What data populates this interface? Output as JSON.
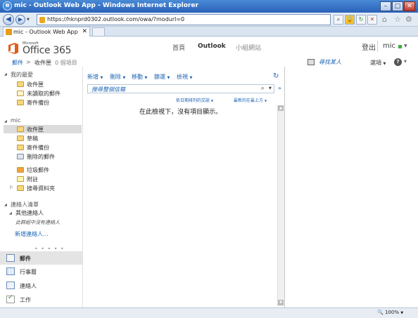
{
  "window": {
    "title": "mic - Outlook Web App - Windows Internet Explorer",
    "url": "https://hknprd0302.outlook.com/owa/?modurl=0",
    "tab_title": "mic - Outlook Web App",
    "controls": {
      "minimize": "–",
      "maximize": "□",
      "close": "✕"
    }
  },
  "owa": {
    "brand_small": "Microsoft",
    "brand": "Office 365",
    "nav": [
      "首頁",
      "Outlook",
      "小組網站"
    ],
    "sign_out": "登出",
    "user": "mic",
    "breadcrumb": {
      "mail": "郵件",
      "folder": "收件匣",
      "count": "0 個項目"
    },
    "find_someone": "尋找某人",
    "options": "選項",
    "help": "?"
  },
  "sidebar": {
    "favorites_title": "我的最愛",
    "favorites": [
      "收件匣",
      "未讀取的郵件",
      "寄件備份"
    ],
    "mailbox_title": "mic",
    "folders": [
      "收件匣",
      "草稿",
      "寄件備份",
      "刪除的郵件",
      "垃圾郵件",
      "附註",
      "搜尋資料夾"
    ],
    "contacts_title": "連絡人清單",
    "other_contacts": "其他連絡人",
    "no_contacts": "此群組中沒有連絡人",
    "new_contact": "新增連絡人...",
    "grip": "• • • • •",
    "bottom_nav": [
      "郵件",
      "行事曆",
      "連絡人",
      "工作"
    ]
  },
  "toolbar": {
    "items": [
      "新增",
      "刪除",
      "移動",
      "篩選",
      "檢視"
    ]
  },
  "search": {
    "placeholder": "搜尋整個信箱"
  },
  "list": {
    "sort_by": "依日期排列的交談",
    "sort_order": "最新的在最上方",
    "empty_message": "在此檢視下，沒有項目顯示。"
  },
  "statusbar": {
    "zoom": "100%"
  },
  "colors": {
    "link": "#1a64b4",
    "ie_title": "#2a62b8",
    "presence": "#3db13d"
  },
  "icons": [
    "ie-icon",
    "back-icon",
    "forward-icon",
    "lock-icon",
    "refresh-icon",
    "stop-icon",
    "home-icon",
    "favorites-star-icon",
    "tools-gear-icon",
    "office-logo-icon",
    "folder-icon",
    "search-icon",
    "help-icon",
    "zoom-icon"
  ]
}
